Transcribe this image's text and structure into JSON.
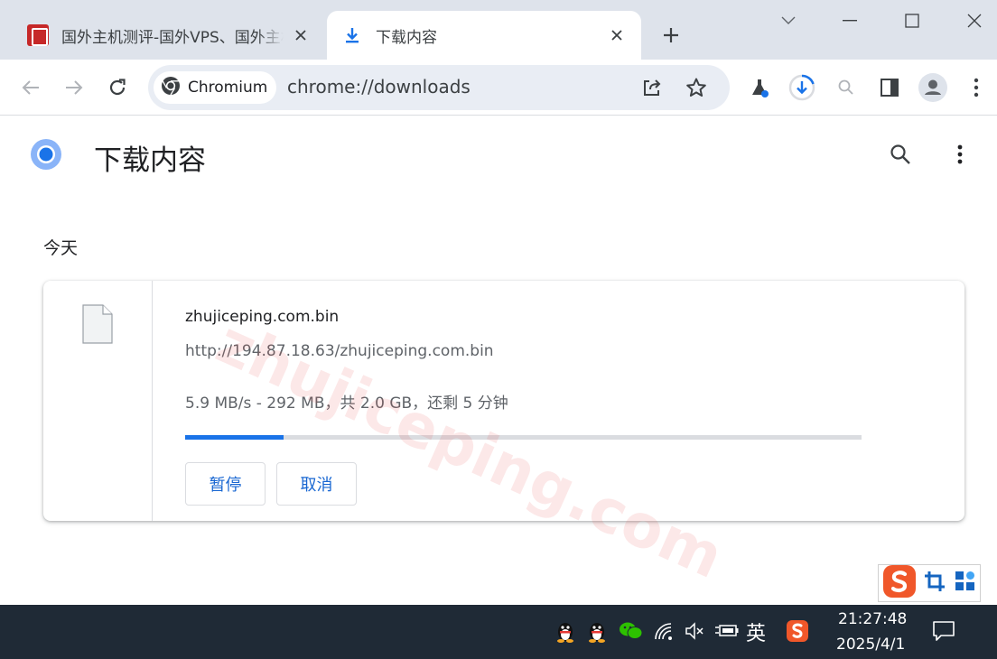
{
  "tabs": [
    {
      "title": "国外主机测评-国外VPS、国外主机",
      "favicon": "site-seal-icon",
      "active": false
    },
    {
      "title": "下载内容",
      "favicon": "download-icon",
      "active": true
    }
  ],
  "omnibox": {
    "chip_label": "Chromium",
    "url": "chrome://downloads"
  },
  "page": {
    "title": "下载内容",
    "section_label": "今天"
  },
  "download": {
    "file_name": "zhujiceping.com.bin",
    "url": "http://194.87.18.63/zhujiceping.com.bin",
    "status": "5.9 MB/s - 292 MB，共 2.0 GB，还剩 5 分钟",
    "progress": 0.146,
    "pause_label": "暂停",
    "cancel_label": "取消"
  },
  "watermark": "zhujiceping.com",
  "taskbar": {
    "ime_label": "英",
    "time": "21:27:48",
    "date": "2025/4/1"
  },
  "colors": {
    "accent": "#1a73e8",
    "tabstrip": "#dee3eb",
    "omnibox": "#e9edf4",
    "taskbar": "#1f2a36"
  }
}
